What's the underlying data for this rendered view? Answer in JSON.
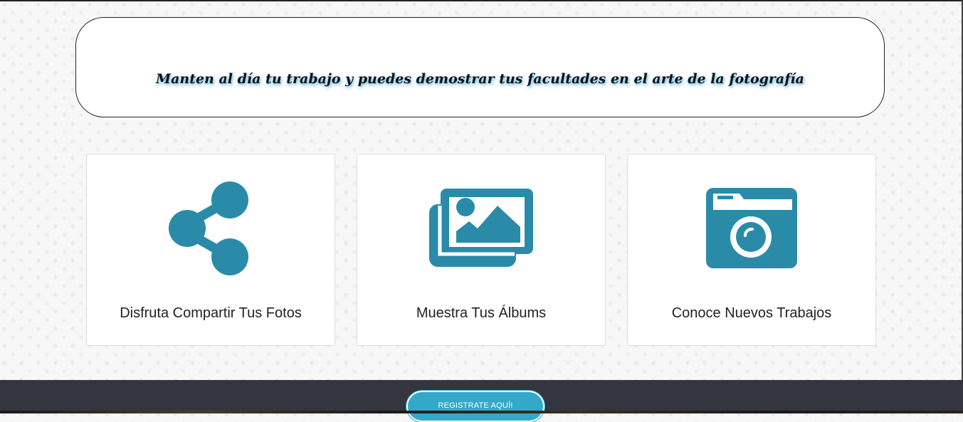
{
  "tagline": "Manten al día tu trabajo y puedes demostrar tus facultades en el arte de la fotografía",
  "accent_color": "#2a8ba9",
  "features": [
    {
      "icon": "share-icon",
      "label": "Disfruta Compartir Tus Fotos"
    },
    {
      "icon": "images-icon",
      "label": "Muestra Tus Álbums"
    },
    {
      "icon": "camera-icon",
      "label": "Conoce Nuevos Trabajos"
    }
  ],
  "footer": {
    "register_label": "REGISTRATE AQUÍ!"
  }
}
